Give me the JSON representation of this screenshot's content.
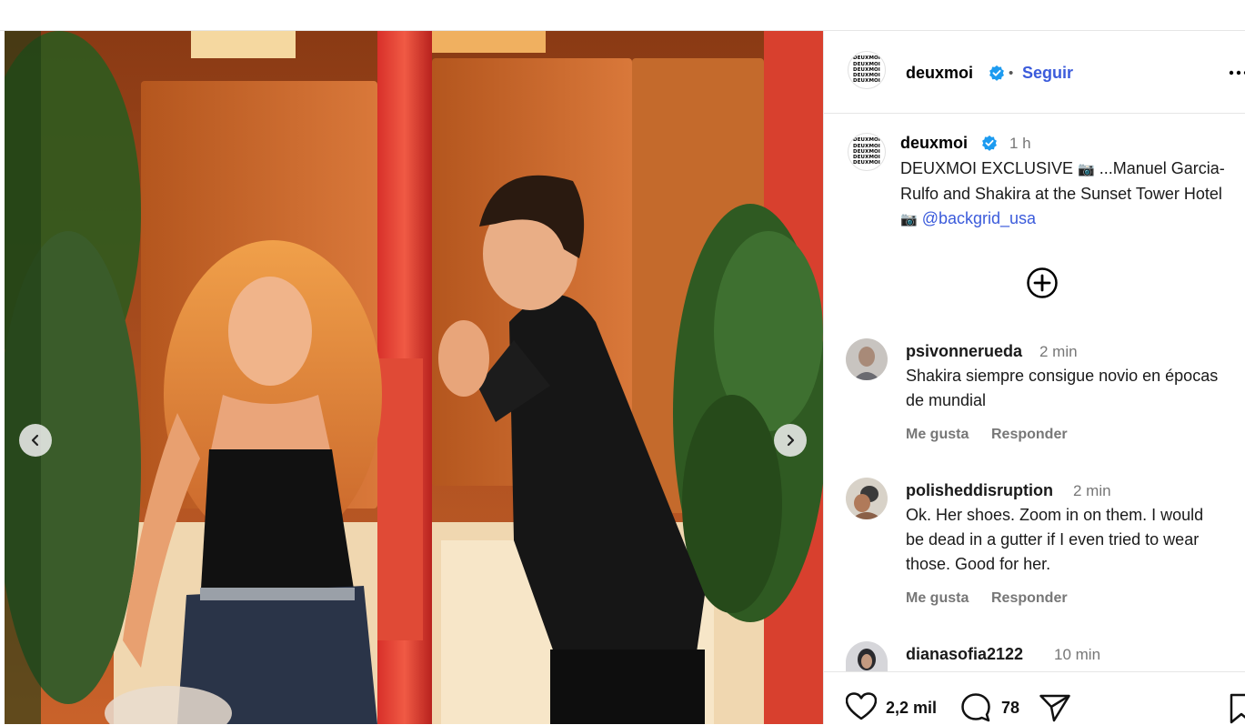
{
  "post": {
    "username": "deuxmoi",
    "follow_label": "Seguir",
    "logo_lines": [
      "DEUXMOI",
      "DEUXMOI",
      "DEUXMOI",
      "DEUXMOI",
      "DEUXMOI"
    ],
    "caption_time": "1 h",
    "caption_before": "DEUXMOI EXCLUSIVE",
    "caption_camera1": "📷",
    "caption_middle": " ...Manuel Garcia-Rulfo and Shakira at the Sunset Tower Hotel ",
    "caption_camera2": "📷",
    "caption_mention": "@backgrid_usa"
  },
  "comments": [
    {
      "user": "psivonnerueda",
      "time": "2 min",
      "text": "Shakira siempre consigue novio en épocas de mundial",
      "like": "Me gusta",
      "reply": "Responder"
    },
    {
      "user": "polisheddisruption",
      "time": "2 min",
      "text": "Ok. Her shoes. Zoom in on them. I would be dead in a gutter if I even tried to wear those. Good for her.",
      "like": "Me gusta",
      "reply": "Responder"
    },
    {
      "user": "dianasofia2122",
      "time": "10 min"
    }
  ],
  "actions": {
    "likes": "2,2 mil",
    "comments": "78"
  },
  "icons": [
    "verified-badge-icon",
    "more-options-icon",
    "add-comment-icon",
    "chevron-left-icon",
    "chevron-right-icon",
    "heart-icon",
    "comment-icon",
    "share-icon",
    "bookmark-icon"
  ],
  "colors": {
    "accent": "#3b5bdb",
    "verified": "#1d9bf0"
  }
}
